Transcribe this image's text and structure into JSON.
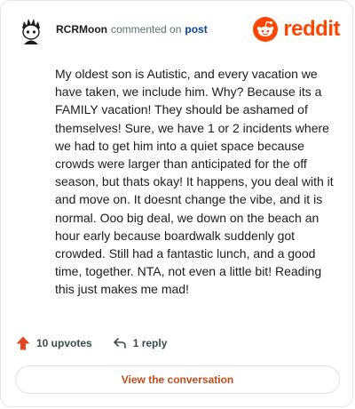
{
  "comment": {
    "author": "RCRMoon",
    "action_text": "commented on",
    "post_link": "post",
    "text": "My oldest son is Autistic, and every vacation we have taken, we include him. Why? Because its a FAMILY vacation! They should be ashamed of themselves! Sure, we have 1 or 2 incidents where we had to get him into a quiet space because crowds were larger than anticipated for the off season, but thats okay! It happens, you deal with it and move on. It doesnt change the vibe, and it is normal. Ooo big deal, we down on the beach an hour early because boardwalk suddenly got crowded. Still had a fantastic lunch, and a good time, together. NTA, not even a little bit! Reading this just makes me mad!"
  },
  "brand": {
    "name": "reddit",
    "icon": "reddit-logo-icon",
    "color": "#ff4500"
  },
  "actions": {
    "upvotes_label": "10 upvotes",
    "upvote_icon": "upvote-arrow-icon",
    "reply_label": "1 reply",
    "reply_icon": "reply-arrow-icon"
  },
  "footer": {
    "view_conversation_label": "View the conversation"
  },
  "colors": {
    "accent": "#ff4500",
    "link": "#0a449b",
    "button_text": "#c44b1a"
  }
}
